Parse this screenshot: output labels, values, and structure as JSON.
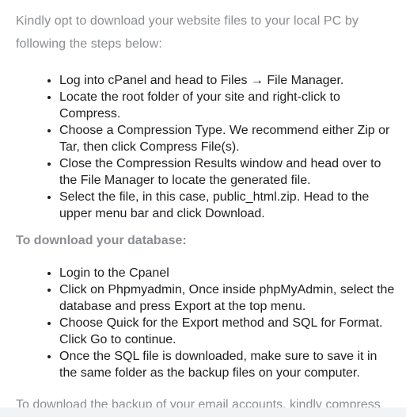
{
  "intro": "Kindly opt to download your website files to your local PC by following the steps below:",
  "website_steps": [
    "Log into cPanel and head to Files → File Manager.",
    "Locate the root folder of your site and right-click to Compress.",
    "Choose a Compression Type. We recommend either Zip or Tar, then click Compress File(s).",
    "Close the Compression Results window and head over to the File Manager to locate the generated file.",
    "Select the file, in this case, public_html.zip. Head to the upper menu bar and click Download."
  ],
  "database_heading": "To download your database:",
  "database_steps": [
    "Login to the Cpanel",
    "Click on Phpmyadmin, Once inside phpMyAdmin, select the database and press Export at the top menu.",
    "Choose Quick for the Export method and SQL for Format. Click Go to continue.",
    "Once the SQL file is downloaded, make sure to save it in the same folder as the backup files on your computer."
  ],
  "trailing_text": "To download the backup of your email accounts, kindly compress"
}
